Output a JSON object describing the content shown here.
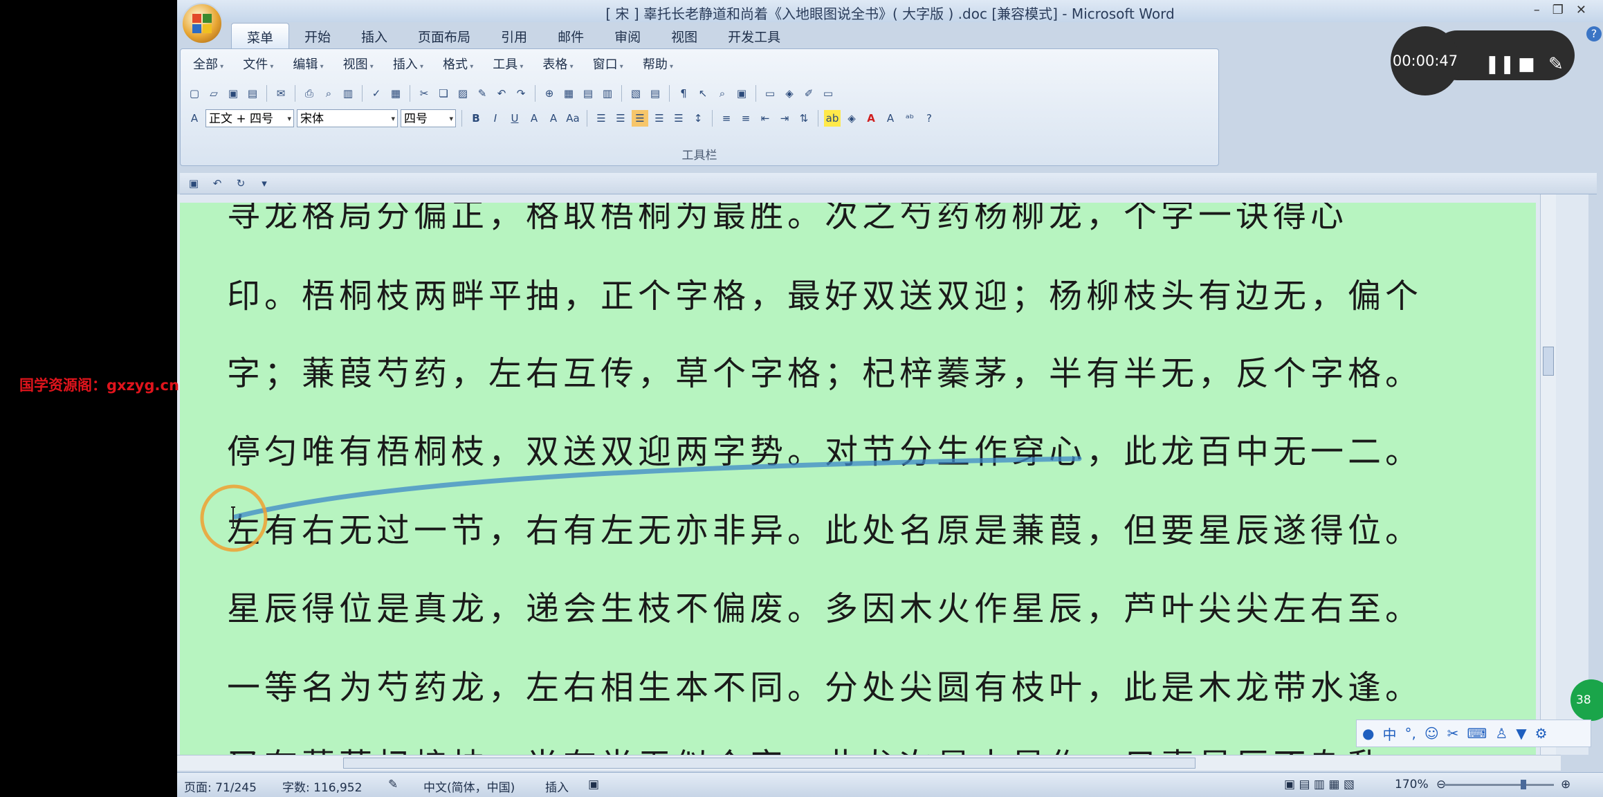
{
  "window": {
    "title": "[ 宋 ] 辜托长老静道和尚着《入地眼图说全书》( 大字版 ) .doc [兼容模式] - Microsoft Word"
  },
  "tabs": [
    {
      "label": "菜单",
      "active": true
    },
    {
      "label": "开始"
    },
    {
      "label": "插入"
    },
    {
      "label": "页面布局"
    },
    {
      "label": "引用"
    },
    {
      "label": "邮件"
    },
    {
      "label": "审阅"
    },
    {
      "label": "视图"
    },
    {
      "label": "开发工具"
    }
  ],
  "menubar": [
    "全部",
    "文件",
    "编辑",
    "视图",
    "插入",
    "格式",
    "工具",
    "表格",
    "窗口",
    "帮助"
  ],
  "format": {
    "style": "正文 + 四号",
    "font": "宋体",
    "size": "四号"
  },
  "ribbon_label": "工具栏",
  "document": {
    "lines": [
      "寻龙格局分偏正，格取梧桐为最胜。次之芍药杨柳龙，个字一诀得心",
      "印。梧桐枝两畔平抽，正个字格，最好双送双迎；杨柳枝头有边无，偏个",
      "字；蒹葭芍药，左右互传，草个字格；杞梓蓁茅，半有半无，反个字格。",
      "停匀唯有梧桐枝，双送双迎两字势。对节分生作穿心，此龙百中无一二。",
      "左有右无过一节，右有左无亦非异。此处名原是蒹葭，但要星辰遂得位。",
      "星辰得位是真龙，递会生枝不偏废。多因木火作星辰，芦叶尖尖左右至。",
      "一等名为芍药龙，左右相生本不同。分处尖圆有枝叶，此是木龙带水逢。",
      "又有蒹葭杞梓枝，半有半无似个字。此龙次是水星作，只喜星辰不杂乱。"
    ]
  },
  "statusbar": {
    "page": "页面: 71/245",
    "words": "字数: 116,952",
    "language": "中文(简体，中国)",
    "mode": "插入",
    "zoom": "170%"
  },
  "watermark": "国学资源阁：gxzyg.cn",
  "recorder": {
    "time": "00:00:47"
  },
  "ime": {
    "badge": "38",
    "lang": "中"
  },
  "colors": {
    "page_bg": "#b7f4c0",
    "watermark": "#e0141c",
    "cursor_ring": "#f0a030"
  }
}
